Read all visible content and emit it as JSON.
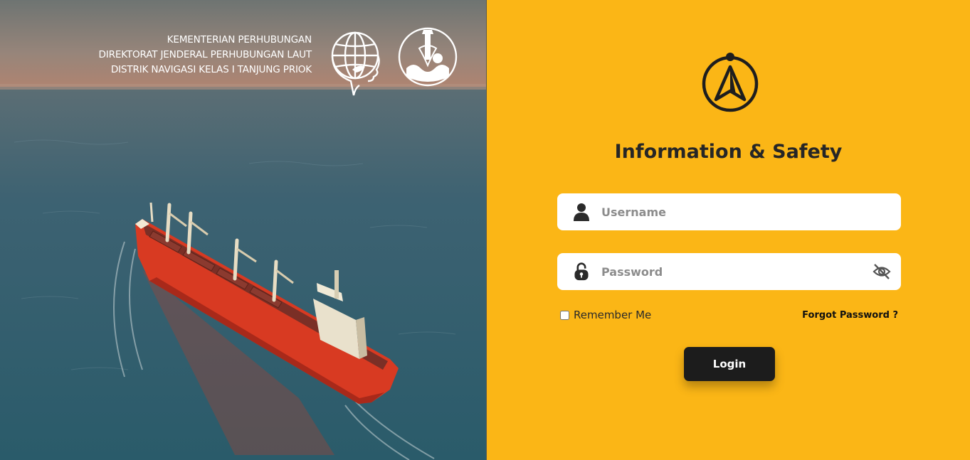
{
  "org": {
    "lines": [
      "KEMENTERIAN PERHUBUNGAN",
      "DIREKTORAT JENDERAL PERHUBUNGAN LAUT",
      "DISTRIK NAVIGASI KELAS I TANJUNG PRIOK"
    ]
  },
  "app": {
    "title": "Information & Safety"
  },
  "login": {
    "username_placeholder": "Username",
    "password_placeholder": "Password",
    "remember_label": "Remember Me",
    "forgot_label": "Forgot Password ?",
    "button_label": "Login"
  },
  "icons": {
    "user": "user-icon",
    "lock": "lock-icon",
    "eye": "eye-slash-icon",
    "app_logo": "compass-logo-icon"
  },
  "colors": {
    "panel_bg": "#fbb616",
    "button_bg": "#1c1c1c",
    "ship_hull": "#d83a22"
  }
}
